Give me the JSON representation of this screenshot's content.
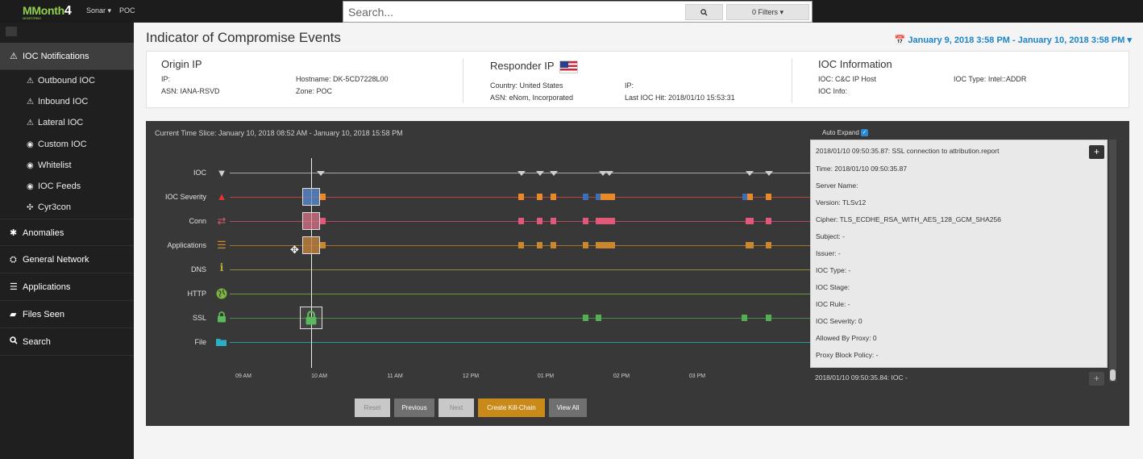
{
  "app": {
    "logo_text": "MMonth",
    "logo_num": "4",
    "logo_sub": "MONITORING",
    "menu_sonar": "Sonar ▾",
    "menu_poc": "POC"
  },
  "search": {
    "placeholder": "Search...",
    "search_icon": "search-icon",
    "filters_label": "0 Filters ▾"
  },
  "sidebar": {
    "groups": [
      {
        "label": "IOC Notifications",
        "icon": "⚠"
      },
      {
        "label": "Anomalies",
        "icon": "✱"
      },
      {
        "label": "General Network",
        "icon": "⛭"
      },
      {
        "label": "Applications",
        "icon": "☰"
      },
      {
        "label": "Files Seen",
        "icon": "▰"
      },
      {
        "label": "Search",
        "icon": "🔍"
      }
    ],
    "sub_items": [
      {
        "label": "Outbound IOC",
        "icon": "⚠"
      },
      {
        "label": "Inbound IOC",
        "icon": "⚠"
      },
      {
        "label": "Lateral IOC",
        "icon": "⚠"
      },
      {
        "label": "Custom IOC",
        "icon": "◉"
      },
      {
        "label": "Whitelist",
        "icon": "◉"
      },
      {
        "label": "IOC Feeds",
        "icon": "◉"
      },
      {
        "label": "Cyr3con",
        "icon": "✣"
      }
    ]
  },
  "main": {
    "title": "Indicator of Compromise Events",
    "date_range": "📅 January 9, 2018 3:58 PM - January 10, 2018 3:58 PM ▾"
  },
  "info": {
    "origin": {
      "title": "Origin IP",
      "ip": "IP:",
      "asn": "ASN: IANA-RSVD",
      "hostname": "Hostname: DK-5CD7228L00",
      "zone": "Zone: POC"
    },
    "responder": {
      "title": "Responder IP",
      "country": "Country: United States",
      "asn": "ASN: eNom, Incorporated",
      "ip": "IP:",
      "last_hit": "Last IOC Hit: 2018/01/10 15:53:31"
    },
    "ioc": {
      "title": "IOC Information",
      "ioc": "IOC: C&C IP Host",
      "ioc_info": "IOC Info:",
      "ioc_type": "IOC Type: Intel::ADDR"
    }
  },
  "timeline": {
    "slice_label": "Current Time Slice: January 10, 2018 08:52 AM - January 10, 2018 15:58 PM",
    "rows": [
      {
        "label": "IOC",
        "icon": "▾",
        "color": "#cfcfcf"
      },
      {
        "label": "IOC Severity",
        "icon": "▲",
        "color": "#e0342e"
      },
      {
        "label": "Conn",
        "icon": "⇄",
        "color": "#e0576b"
      },
      {
        "label": "Applications",
        "icon": "☰",
        "color": "#d08a2b"
      },
      {
        "label": "DNS",
        "icon": "i",
        "color": "#b8a838"
      },
      {
        "label": "HTTP",
        "icon": "◉",
        "color": "#7ab540"
      },
      {
        "label": "SSL",
        "icon": "🔒",
        "color": "#5cb85c"
      },
      {
        "label": "File",
        "icon": "▰",
        "color": "#2ab0c0"
      }
    ],
    "axis_labels": [
      "09 AM",
      "10 AM",
      "11 AM",
      "12 PM",
      "01 PM",
      "02 PM",
      "03 PM"
    ],
    "buttons": {
      "reset": "Reset",
      "previous": "Previous",
      "next": "Next",
      "kill_chain": "Create Kill-Chain",
      "view_all": "View All"
    }
  },
  "detail": {
    "auto_expand": "Auto Expand",
    "lines": [
      "2018/01/10 09:50:35.87: SSL connection to attribution.report",
      "Time: 2018/01/10 09:50:35.87",
      "Server Name:",
      "Version: TLSv12",
      "Cipher: TLS_ECDHE_RSA_WITH_AES_128_GCM_SHA256",
      "Subject: -",
      "Issuer: -",
      "IOC Type: -",
      "IOC Stage:",
      "IOC Rule: -",
      "IOC Severity: 0",
      "Allowed By Proxy: 0",
      "Proxy Block Policy: -"
    ],
    "footer": "2018/01/10 09:50:35.84: IOC -",
    "plus": "+"
  }
}
